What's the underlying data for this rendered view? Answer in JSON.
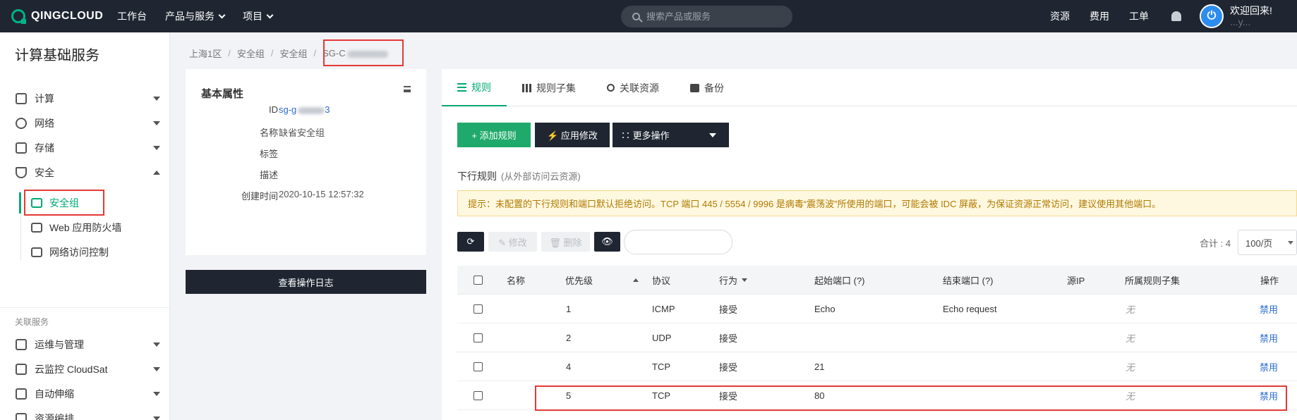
{
  "topbar": {
    "logo_text": "QINGCLOUD",
    "nav": [
      {
        "label": "工作台",
        "dropdown": false
      },
      {
        "label": "产品与服务",
        "dropdown": true
      },
      {
        "label": "项目",
        "dropdown": true
      }
    ],
    "search_placeholder": "搜索产品或服务",
    "right_links": [
      "资源",
      "费用",
      "工单"
    ],
    "welcome": "欢迎回来!",
    "username": "...y..."
  },
  "sidebar": {
    "title": "计算基础服务",
    "items": [
      {
        "label": "计算",
        "icon": "chip-icon",
        "expanded": false
      },
      {
        "label": "网络",
        "icon": "network-icon",
        "expanded": false
      },
      {
        "label": "存储",
        "icon": "storage-icon",
        "expanded": false
      },
      {
        "label": "安全",
        "icon": "shield-icon",
        "expanded": true
      }
    ],
    "security_children": [
      {
        "label": "安全组",
        "icon": "security-group-icon",
        "active": true
      },
      {
        "label": "Web 应用防火墙",
        "icon": "waf-icon",
        "active": false
      },
      {
        "label": "网络访问控制",
        "icon": "access-control-icon",
        "active": false
      }
    ],
    "related_section": "关联服务",
    "related_items": [
      {
        "label": "运维与管理",
        "icon": "ops-icon"
      },
      {
        "label": "云监控 CloudSat",
        "icon": "monitor-icon"
      },
      {
        "label": "自动伸缩",
        "icon": "autoscale-icon"
      },
      {
        "label": "资源编排",
        "icon": "orchestration-icon"
      }
    ]
  },
  "breadcrumb": [
    "上海1区",
    "安全组",
    "安全组",
    "SG-C"
  ],
  "properties": {
    "title": "基本属性",
    "rows": [
      {
        "label": "ID",
        "value": "sg-g",
        "value_suffix": "3",
        "blurred": true,
        "link": true
      },
      {
        "label": "名称",
        "value": "缺省安全组"
      },
      {
        "label": "标签",
        "value": ""
      },
      {
        "label": "描述",
        "value": ""
      },
      {
        "label": "创建时间",
        "value": "2020-10-15 12:57:32"
      }
    ],
    "log_button": "查看操作日志"
  },
  "tabs": [
    {
      "label": "规则",
      "icon": "list-icon",
      "active": true
    },
    {
      "label": "规则子集",
      "icon": "grid-icon",
      "active": false
    },
    {
      "label": "关联资源",
      "icon": "gear-icon",
      "active": false
    },
    {
      "label": "备份",
      "icon": "camera-icon",
      "active": false
    }
  ],
  "actions": {
    "add_rule": "+ 添加规则",
    "apply": "⚡ 应用修改",
    "more": "∷ 更多操作"
  },
  "rules_section": {
    "title": "下行规则",
    "subtitle": "(从外部访问云资源)",
    "notice": "提示：未配置的下行规则和端口默认拒绝访问。TCP 端口 445 / 5554 / 9996 是病毒“震荡波”所使用的端口，可能会被 IDC 屏蔽，为保证资源正常访问，建议使用其他端口。"
  },
  "toolbar": {
    "refresh": "⟳",
    "edit": "✎ 修改",
    "delete": "🗑 删除",
    "view": "👁",
    "filter_value": "",
    "total": "合计 : 4",
    "page_size": "100/页"
  },
  "table": {
    "headers": {
      "name": "名称",
      "priority": "优先级",
      "protocol": "协议",
      "action": "行为",
      "start_port": "起始端口 (?)",
      "end_port": "结束端口 (?)",
      "source_ip": "源IP",
      "subset": "所属规则子集",
      "ops": "操作"
    },
    "rows": [
      {
        "name": "",
        "priority": "1",
        "protocol": "ICMP",
        "action": "接受",
        "start_port": "Echo",
        "end_port": "Echo request",
        "source_ip": "",
        "subset": "无",
        "op": "禁用"
      },
      {
        "name": "",
        "priority": "2",
        "protocol": "UDP",
        "action": "接受",
        "start_port": "",
        "end_port": "",
        "source_ip": "",
        "subset": "无",
        "op": "禁用"
      },
      {
        "name": "",
        "priority": "4",
        "protocol": "TCP",
        "action": "接受",
        "start_port": "21",
        "end_port": "",
        "source_ip": "",
        "subset": "无",
        "op": "禁用"
      },
      {
        "name": "",
        "priority": "5",
        "protocol": "TCP",
        "action": "接受",
        "start_port": "80",
        "end_port": "",
        "source_ip": "",
        "subset": "无",
        "op": "禁用"
      }
    ]
  },
  "colors": {
    "topbar": "#1f2631",
    "accent": "#00a971",
    "link": "#2d6ccf",
    "highlight": "#e53935"
  }
}
